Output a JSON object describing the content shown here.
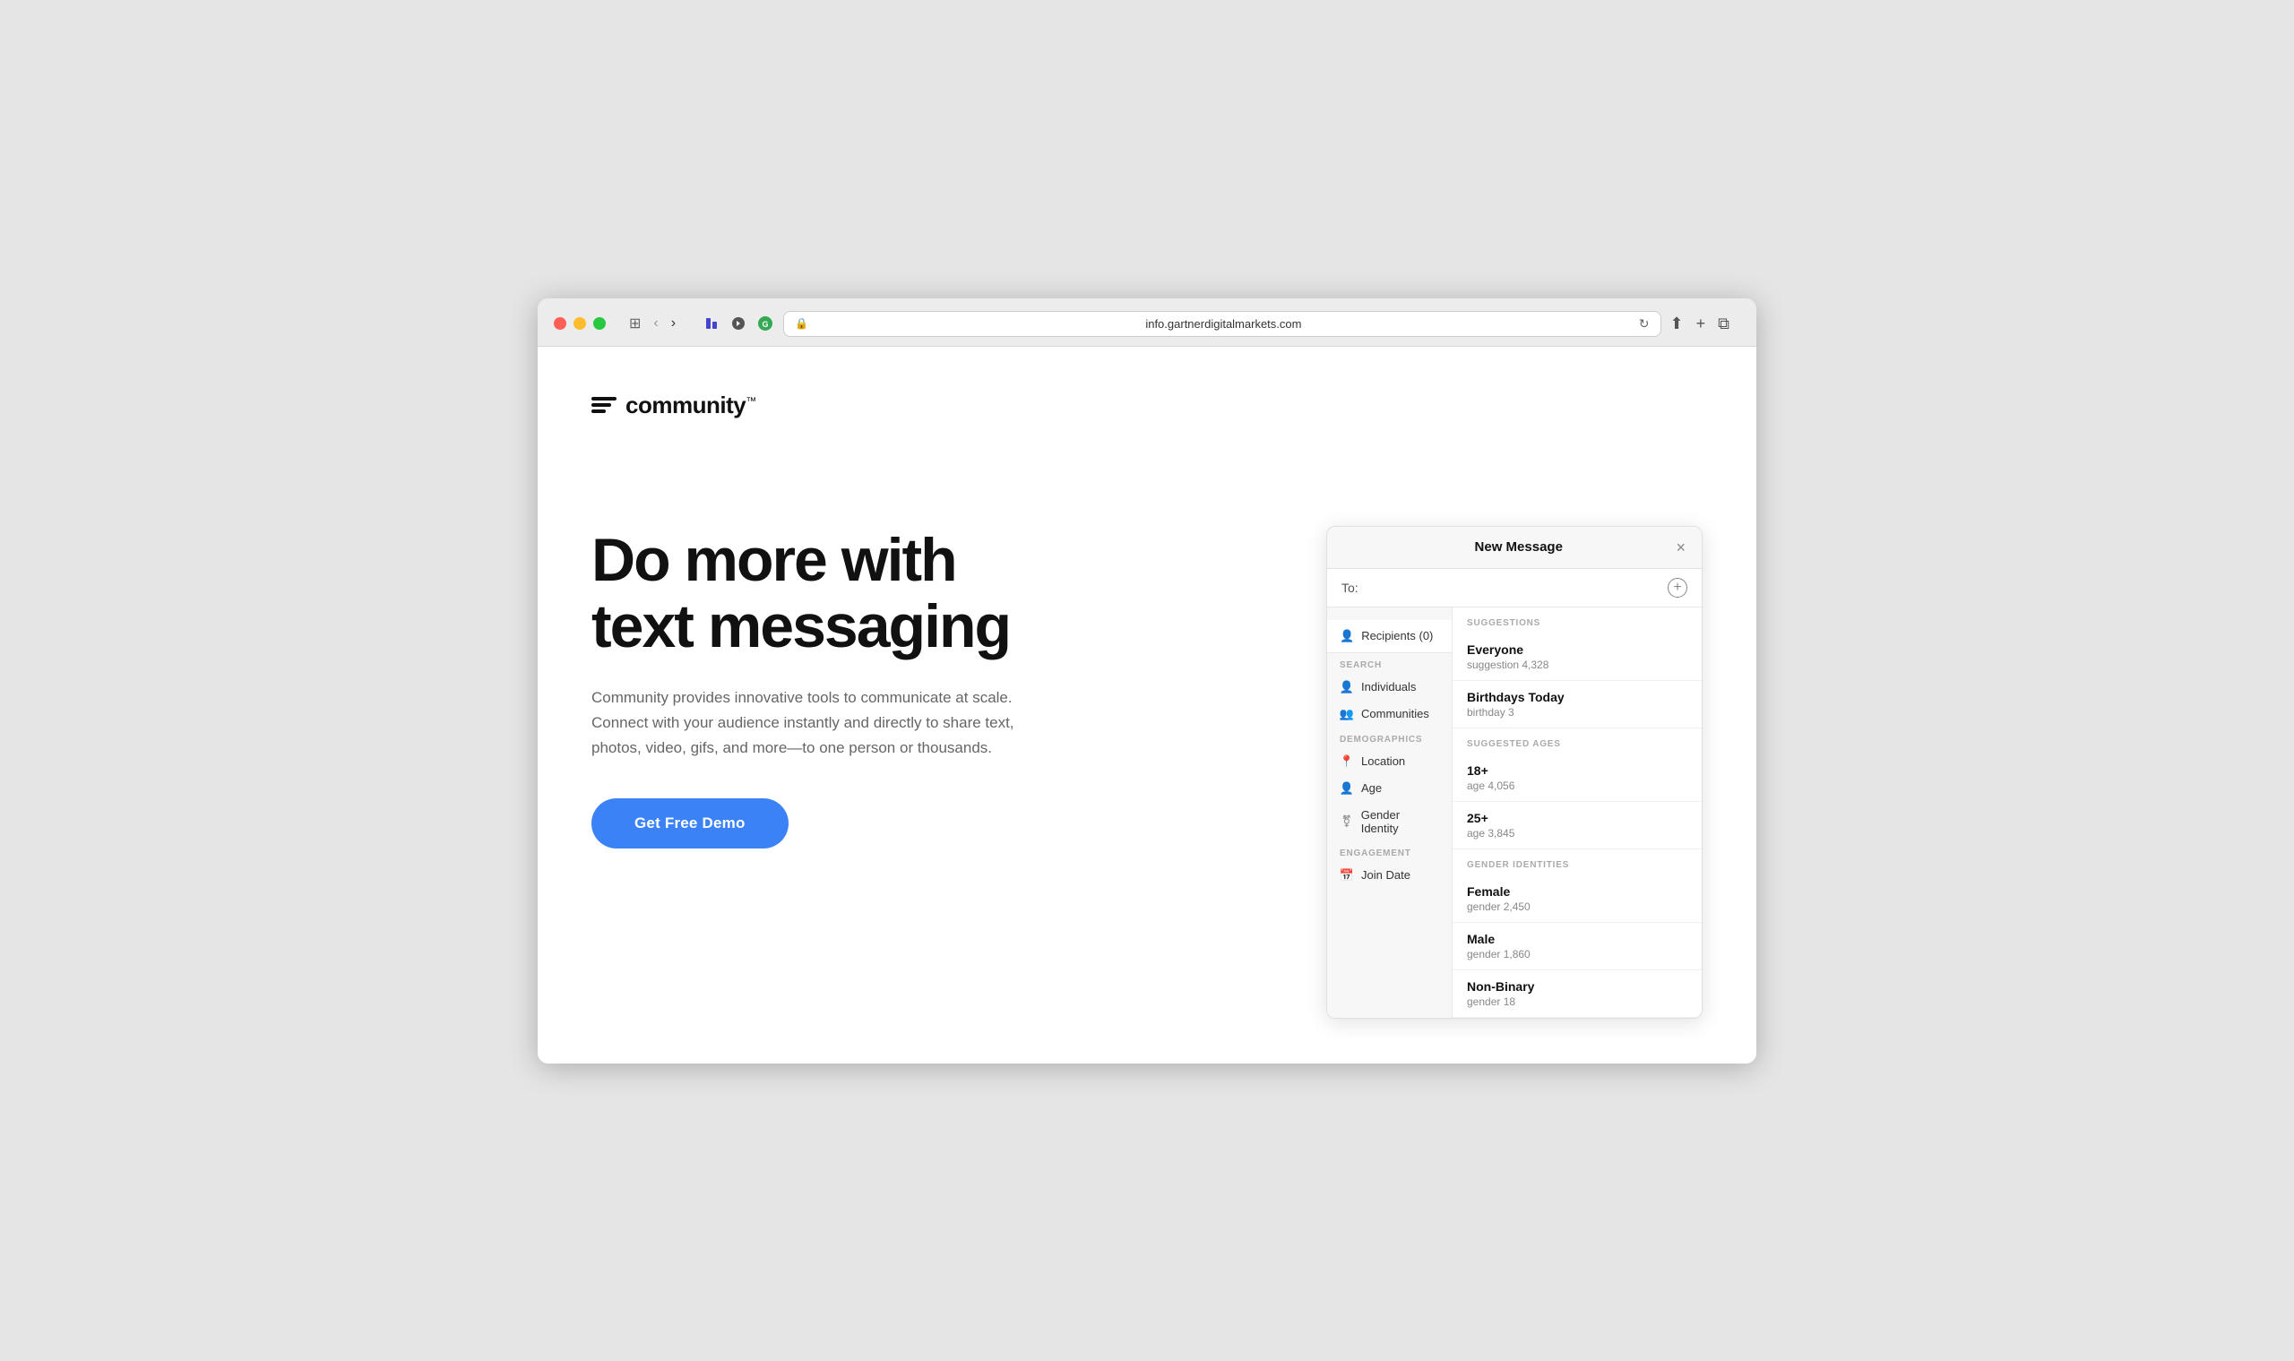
{
  "browser": {
    "url": "info.gartnerdigitalmarkets.com",
    "tl_red": "red",
    "tl_yellow": "yellow",
    "tl_green": "green"
  },
  "logo": {
    "text": "community",
    "tm": "™"
  },
  "hero": {
    "headline_line1": "Do more with",
    "headline_line2": "text messaging",
    "subtext": "Community provides innovative tools to communicate at scale. Connect with your audience instantly and directly to share text, photos, video, gifs, and more—to one person or thousands.",
    "cta_label": "Get Free Demo"
  },
  "message_panel": {
    "title": "New Message",
    "close": "×",
    "to_label": "To:",
    "recipients_label": "Recipients (0)",
    "sections": {
      "search_label": "SEARCH",
      "search_items": [
        {
          "icon": "person",
          "label": "Individuals"
        },
        {
          "icon": "group",
          "label": "Communities"
        }
      ],
      "demographics_label": "DEMOGRAPHICS",
      "demographics_items": [
        {
          "icon": "location",
          "label": "Location"
        },
        {
          "icon": "age",
          "label": "Age"
        },
        {
          "icon": "gender",
          "label": "Gender Identity"
        }
      ],
      "engagement_label": "ENGAGEMENT",
      "engagement_items": [
        {
          "icon": "calendar",
          "label": "Join Date"
        }
      ]
    },
    "suggestions_label": "SUGGESTIONS",
    "suggestions": [
      {
        "name": "Everyone",
        "sub": "suggestion 4,328"
      },
      {
        "name": "Birthdays Today",
        "sub": "birthday 3"
      }
    ],
    "ages_label": "SUGGESTED AGES",
    "ages": [
      {
        "name": "18+",
        "sub": "age 4,056"
      },
      {
        "name": "25+",
        "sub": "age 3,845"
      }
    ],
    "genders_label": "GENDER IDENTITIES",
    "genders": [
      {
        "name": "Female",
        "sub": "gender 2,450"
      },
      {
        "name": "Male",
        "sub": "gender 1,860"
      },
      {
        "name": "Non-Binary",
        "sub": "gender 18"
      }
    ]
  }
}
